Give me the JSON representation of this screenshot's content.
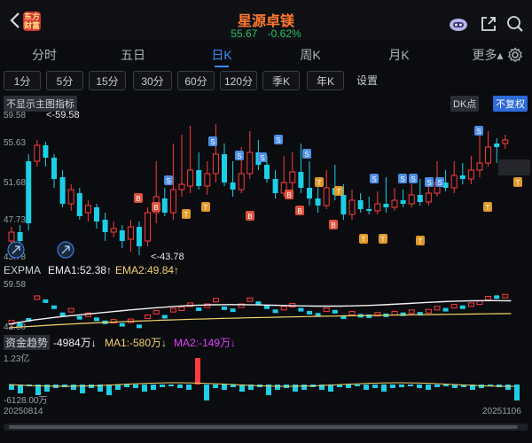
{
  "header": {
    "title": "星源卓镁",
    "price": "55.67",
    "change": "-0.62%",
    "logo_text": "东方财富"
  },
  "tabs": [
    {
      "label": "分时"
    },
    {
      "label": "五日"
    },
    {
      "label": "日K"
    },
    {
      "label": "周K"
    },
    {
      "label": "月K"
    },
    {
      "label": "更多▴"
    }
  ],
  "periods": [
    "1分",
    "5分",
    "15分",
    "30分",
    "60分",
    "120分",
    "季K",
    "年K",
    "设置"
  ],
  "main_chart": {
    "indicator_toggle": "不显示主图指标",
    "dk_label": "DK点",
    "rehab_label": "不复权",
    "y_ticks": [
      "59.58",
      "55.63",
      "51.68",
      "47.73",
      "43.78"
    ],
    "high_marker": "<-59.58",
    "low_marker": "<-43.78"
  },
  "ema_panel": {
    "label": "EXPMA",
    "ema1": "EMA1:52.38↑",
    "ema2": "EMA2:49.84↑",
    "top": "59.58",
    "bottom": "43.60"
  },
  "fund_panel": {
    "label": "资金趋势",
    "value": "-4984万↓",
    "ma1": "MA1:-580万↓",
    "ma2": "MA2:-149万↓",
    "top": "1.23亿",
    "bottom": "-6128.00万"
  },
  "dates": {
    "start": "20250814",
    "end": "20251106"
  },
  "colors": {
    "up": "#ff3b3b",
    "down": "#1ccfe6",
    "accent": "#3d8bff",
    "price_down": "#27c26a"
  }
}
